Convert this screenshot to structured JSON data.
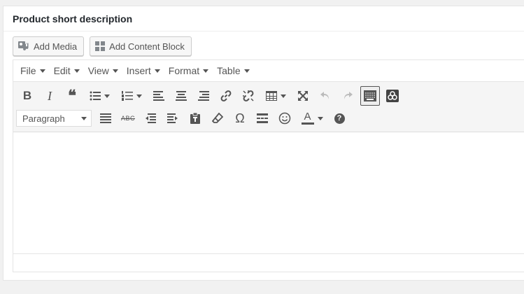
{
  "panel": {
    "title": "Product short description"
  },
  "media_buttons": {
    "add_media": "Add Media",
    "add_content_block": "Add Content Block"
  },
  "menubar": {
    "items": [
      "File",
      "Edit",
      "View",
      "Insert",
      "Format",
      "Table"
    ]
  },
  "toolbar": {
    "format_select": "Paragraph",
    "row1_icons": [
      "bold-icon",
      "italic-icon",
      "blockquote-icon",
      "bullet-list-icon",
      "numbered-list-icon",
      "align-left-icon",
      "align-center-icon",
      "align-right-icon",
      "link-icon",
      "unlink-icon",
      "table-icon",
      "fullscreen-icon",
      "undo-icon",
      "redo-icon",
      "toolbar-toggle-icon",
      "content-block-icon"
    ],
    "row2_icons": [
      "justify-icon",
      "strikethrough-icon",
      "outdent-icon",
      "indent-icon",
      "paste-text-icon",
      "clear-formatting-icon",
      "special-character-icon",
      "read-more-icon",
      "emoticons-icon",
      "text-color-icon",
      "help-icon"
    ],
    "bold": "B",
    "italic": "I",
    "blockquote": "❝",
    "omega": "Ω",
    "help": "?",
    "strike": "ABC",
    "textcolor": "A"
  },
  "editor": {
    "content": ""
  },
  "colors": {
    "accent": "#555555",
    "border": "#e5e5e5",
    "toolbar_bg": "#f5f5f5"
  }
}
